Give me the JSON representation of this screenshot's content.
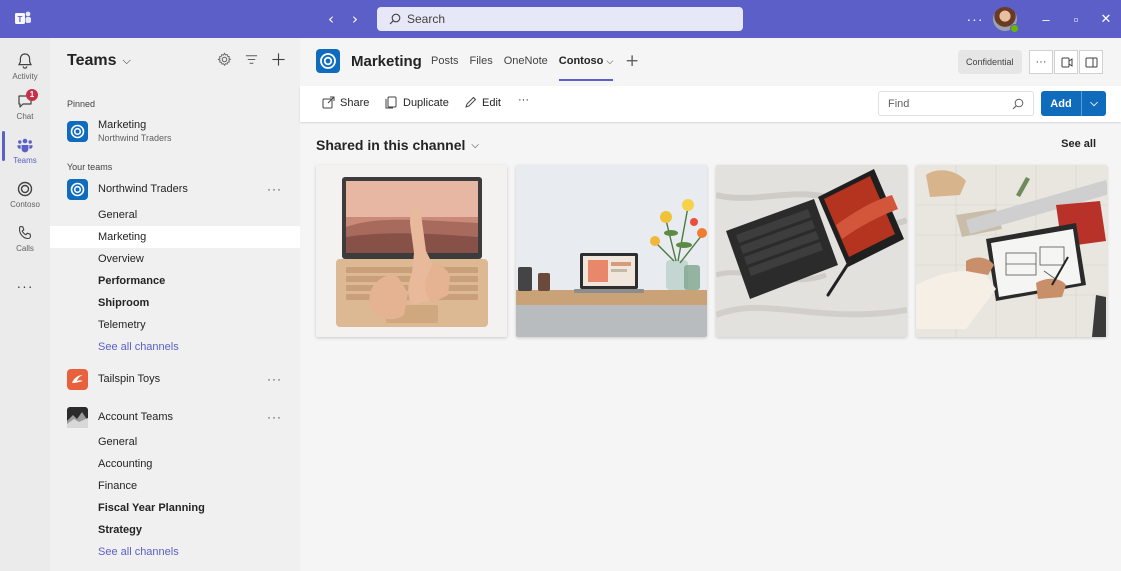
{
  "titlebar": {
    "app_icon": "teams-logo-icon",
    "back_icon": "chevron-left-icon",
    "forward_icon": "chevron-right-icon",
    "search_placeholder": "Search",
    "more_icon": "more-horizontal-icon",
    "minimize_icon": "minimize-icon",
    "maximize_icon": "maximize-icon",
    "close_icon": "close-icon"
  },
  "rail": {
    "items": [
      {
        "label": "Activity",
        "icon": "bell-icon"
      },
      {
        "label": "Chat",
        "icon": "chat-icon",
        "badge": "1"
      },
      {
        "label": "Teams",
        "icon": "teams-icon",
        "active": true
      },
      {
        "label": "Contoso",
        "icon": "contoso-app-icon"
      },
      {
        "label": "Calls",
        "icon": "phone-icon"
      }
    ],
    "more": "···"
  },
  "teams_pane": {
    "title": "Teams",
    "pinned_label": "Pinned",
    "pinned": {
      "name": "Marketing",
      "sub": "Northwind Traders"
    },
    "your_teams_label": "Your teams",
    "teams": [
      {
        "name": "Northwind Traders",
        "channels": [
          {
            "name": "General",
            "bold": false
          },
          {
            "name": "Marketing",
            "bold": false,
            "selected": true
          },
          {
            "name": "Overview",
            "bold": false
          },
          {
            "name": "Performance",
            "bold": true
          },
          {
            "name": "Shiproom",
            "bold": true
          },
          {
            "name": "Telemetry",
            "bold": false
          },
          {
            "name": "See all channels",
            "link": true
          }
        ]
      },
      {
        "name": "Tailspin Toys",
        "channels": []
      },
      {
        "name": "Account Teams",
        "channels": [
          {
            "name": "General",
            "bold": false
          },
          {
            "name": "Accounting",
            "bold": false
          },
          {
            "name": "Finance",
            "bold": false
          },
          {
            "name": "Fiscal Year Planning",
            "bold": true
          },
          {
            "name": "Strategy",
            "bold": true
          },
          {
            "name": "See all channels",
            "link": true
          }
        ]
      }
    ]
  },
  "channel_header": {
    "title": "Marketing",
    "tabs": [
      "Posts",
      "Files",
      "OneNote",
      "Contoso"
    ],
    "active_tab": "Contoso",
    "confidential": "Confidential"
  },
  "toolbar": {
    "share": "Share",
    "duplicate": "Duplicate",
    "edit": "Edit",
    "more": "···",
    "find_placeholder": "Find",
    "add": "Add"
  },
  "content": {
    "section_title": "Shared in this channel",
    "see_all": "See all",
    "tiles": [
      {
        "subject": "laptop-typing-photo"
      },
      {
        "subject": "desk-laptop-flowers-photo"
      },
      {
        "subject": "tablet-keyboard-photo"
      },
      {
        "subject": "tablet-drawing-photo"
      }
    ]
  },
  "colors": {
    "brand": "#5b5fc7",
    "accent_blue": "#0f6cbd",
    "badge": "#c4314b"
  }
}
